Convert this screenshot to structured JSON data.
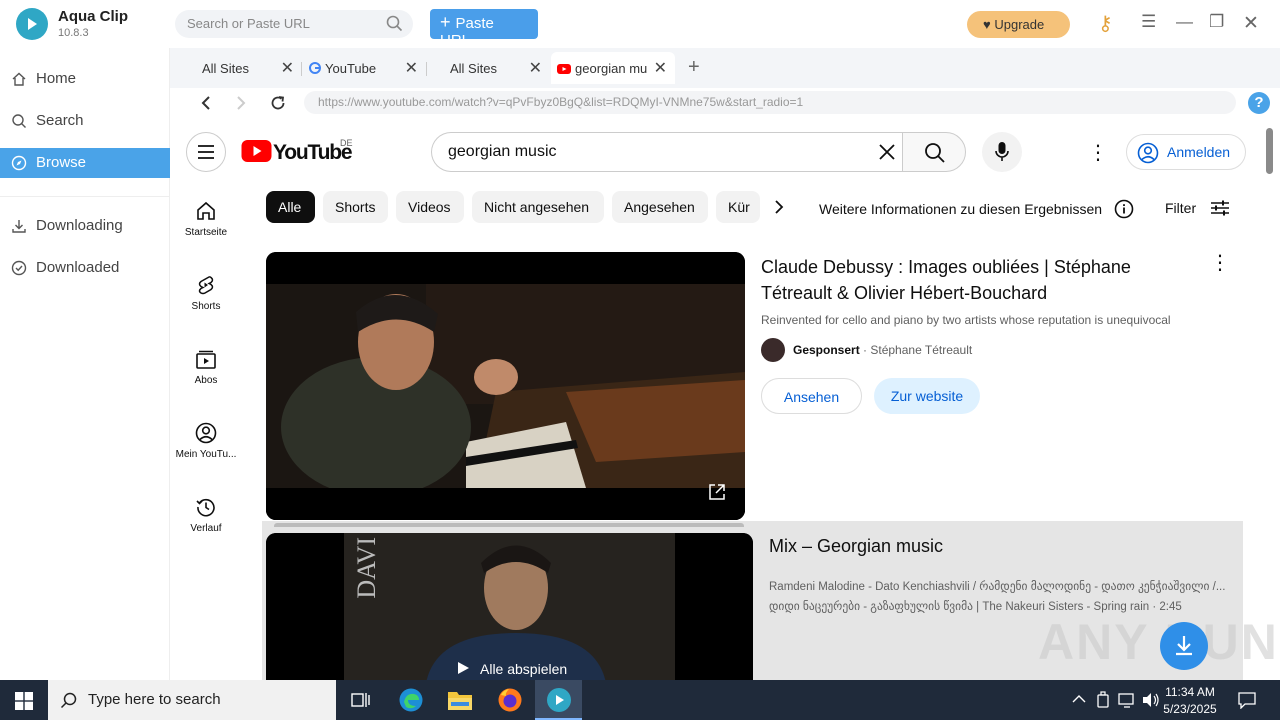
{
  "app": {
    "name": "Aqua Clip",
    "version": "10.8.3",
    "search_placeholder": "Search or Paste URL",
    "paste_label": "Paste URL",
    "upgrade_label": "Upgrade"
  },
  "sidebar": {
    "items": [
      {
        "label": "Home"
      },
      {
        "label": "Search"
      },
      {
        "label": "Browse"
      },
      {
        "label": "Downloading"
      },
      {
        "label": "Downloaded"
      }
    ]
  },
  "tabs": [
    {
      "label": "All Sites"
    },
    {
      "label": "YouTube"
    },
    {
      "label": "All Sites"
    },
    {
      "label": "georgian mu"
    }
  ],
  "browser": {
    "url": "https://www.youtube.com/watch?v=qPvFbyz0BgQ&list=RDQMyI-VNMne75w&start_radio=1"
  },
  "youtube": {
    "logo_text": "YouTube",
    "region": "DE",
    "search_value": "georgian music",
    "signin_label": "Anmelden",
    "chips": [
      "Alle",
      "Shorts",
      "Videos",
      "Nicht angesehen",
      "Angesehen",
      "Kür"
    ],
    "more_info": "Weitere Informationen zu diesen Ergebnissen",
    "filter_label": "Filter",
    "guide": [
      "Startseite",
      "Shorts",
      "Abos",
      "Mein YouTu...",
      "Verlauf"
    ],
    "result1": {
      "title": "Claude Debussy : Images oubliées | Stéphane Tétreault & Olivier Hébert-Bouchard",
      "description": "Reinvented for cello and piano by two artists whose reputation is unequivocal",
      "sponsored": "Gesponsert",
      "channel": "Stéphane Tétreault",
      "watch_label": "Ansehen",
      "site_label": "Zur website"
    },
    "result2": {
      "title": "Mix – Georgian music",
      "line1": "Ramdeni Malodine - Dato Kenchiashvili / რამდენი მალოდინე - დათო კენჭიაშვილი /...",
      "line2": "დიდი ნაცეურები - გაზაფხულის წვიმა | The Nakeuri Sisters - Spring rain · 2:45",
      "play_all": "Alle abspielen",
      "thumb_text": "DAVI"
    }
  },
  "watermark": "ANY RUN",
  "taskbar": {
    "search_placeholder": "Type here to search",
    "time": "11:34 AM",
    "date": "5/23/2025"
  }
}
